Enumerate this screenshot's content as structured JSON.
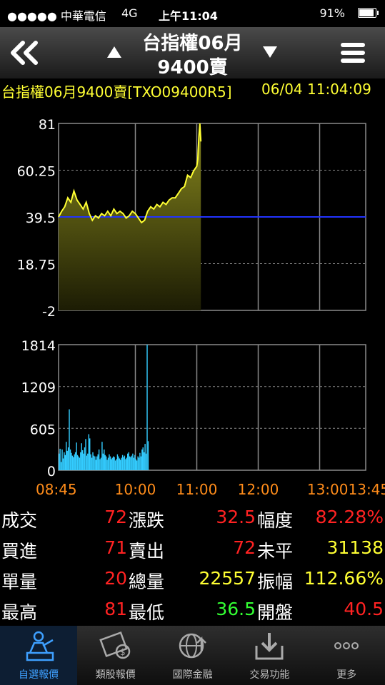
{
  "status": {
    "carrier": "●●●●● 中華電信",
    "network": "4G",
    "time": "上午11:04",
    "battery": "91%",
    "battery_level": 0.91
  },
  "nav": {
    "title": "台指權06月",
    "subtitle": "9400賣"
  },
  "ticker": {
    "name": "台指權06月9400賣[TXO09400R5]",
    "datetime": "06/04 11:04:09"
  },
  "colors": {
    "price_line": "#ffff33",
    "volume": "#33ccff",
    "reference": "#2233ff",
    "up": "#ff2222",
    "down": "#33ff33",
    "neutral": "#ffff33",
    "axis_time": "#ff8c1a",
    "tab_active": "#3ea0ff"
  },
  "chart_data": [
    {
      "type": "area",
      "ylim": [
        -2,
        81
      ],
      "y_ticks": [
        "81",
        "60.25",
        "39.5",
        "18.75",
        "-2"
      ],
      "reference_line": 39.5,
      "x_ticks": [
        "08:45",
        "10:00",
        "11:00",
        "12:00",
        "13:00",
        "13:45"
      ],
      "series": [
        {
          "x": [
            "08:45",
            "08:48",
            "08:51",
            "08:54",
            "08:57",
            "09:00",
            "09:03",
            "09:06",
            "09:09",
            "09:12",
            "09:15",
            "09:18",
            "09:21",
            "09:24",
            "09:27",
            "09:30",
            "09:33",
            "09:36",
            "09:39",
            "09:42",
            "09:45",
            "09:48",
            "09:51",
            "09:54",
            "09:57",
            "10:00",
            "10:03",
            "10:06",
            "10:09",
            "10:12",
            "10:15",
            "10:18",
            "10:21",
            "10:24",
            "10:27",
            "10:30",
            "10:33",
            "10:36",
            "10:39",
            "10:42",
            "10:45",
            "10:48",
            "10:51",
            "10:54",
            "10:57",
            "11:00",
            "11:01",
            "11:02",
            "11:03",
            "11:04"
          ],
          "values": [
            39.5,
            42,
            44,
            48,
            46,
            51,
            47,
            45,
            43,
            46,
            41,
            38,
            40,
            39,
            41,
            40,
            42,
            40,
            43,
            41,
            42,
            41,
            39,
            40,
            42,
            41,
            39,
            37,
            38,
            42,
            44,
            43,
            45,
            44,
            46,
            45,
            47,
            48,
            48,
            50,
            52,
            53,
            58,
            57,
            60,
            62,
            65,
            75,
            81,
            73
          ]
        }
      ]
    },
    {
      "type": "bar",
      "ylim": [
        0,
        1814
      ],
      "y_ticks": [
        "1814",
        "1209",
        "605",
        "0"
      ],
      "x_ticks": [
        "08:45",
        "10:00",
        "11:00",
        "12:00",
        "13:00",
        "13:45"
      ],
      "series": [
        {
          "x_start": "08:45",
          "step_minutes": 1,
          "values": [
            240,
            310,
            120,
            300,
            170,
            260,
            220,
            410,
            280,
            330,
            880,
            300,
            250,
            210,
            190,
            230,
            260,
            400,
            220,
            200,
            180,
            260,
            390,
            290,
            240,
            330,
            450,
            210,
            240,
            520,
            460,
            230,
            180,
            260,
            210,
            200,
            150,
            200,
            230,
            300,
            160,
            180,
            410,
            240,
            300,
            220,
            200,
            150,
            180,
            230,
            200,
            160,
            180,
            200,
            190,
            140,
            160,
            230,
            200,
            170,
            150,
            180,
            220,
            190,
            210,
            160,
            180,
            240,
            260,
            200,
            190,
            210,
            240,
            180,
            220,
            160,
            140,
            200,
            180,
            250,
            200,
            300,
            330,
            260,
            380,
            240,
            1814,
            420
          ]
        }
      ]
    }
  ],
  "stats": [
    [
      {
        "label": "成交",
        "value": "72",
        "color": "up"
      },
      {
        "label": "漲跌",
        "value": "32.5",
        "color": "up"
      },
      {
        "label": "幅度",
        "value": "82.28%",
        "color": "up"
      }
    ],
    [
      {
        "label": "買進",
        "value": "71",
        "color": "up"
      },
      {
        "label": "賣出",
        "value": "72",
        "color": "up"
      },
      {
        "label": "未平",
        "value": "31138",
        "color": "neutral"
      }
    ],
    [
      {
        "label": "單量",
        "value": "20",
        "color": "up"
      },
      {
        "label": "總量",
        "value": "22557",
        "color": "neutral"
      },
      {
        "label": "振幅",
        "value": "112.66%",
        "color": "neutral"
      }
    ],
    [
      {
        "label": "最高",
        "value": "81",
        "color": "up"
      },
      {
        "label": "最低",
        "value": "36.5",
        "color": "down"
      },
      {
        "label": "開盤",
        "value": "40.5",
        "color": "up"
      }
    ]
  ],
  "tabs": [
    {
      "label": "自選報價",
      "icon": "stock-picker-icon",
      "active": true
    },
    {
      "label": "類股報價",
      "icon": "film-coin-icon",
      "active": false
    },
    {
      "label": "國際金融",
      "icon": "globe-icon",
      "active": false
    },
    {
      "label": "交易功能",
      "icon": "tray-download-icon",
      "active": false
    },
    {
      "label": "更多",
      "icon": "more-dots-icon",
      "active": false
    }
  ]
}
